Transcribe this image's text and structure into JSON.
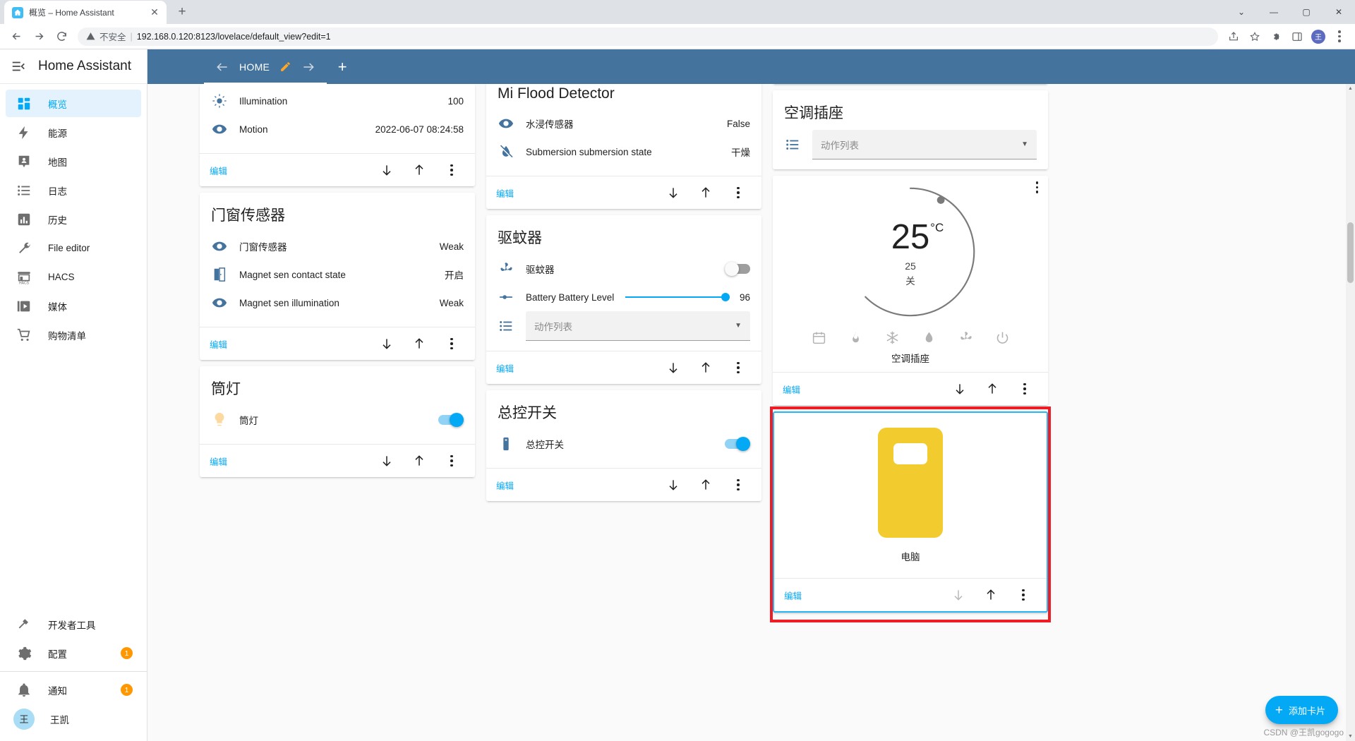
{
  "browser": {
    "tab_title": "概览 – Home Assistant",
    "tab_close": "✕",
    "new_tab": "+",
    "url_warning": "不安全",
    "url_separator": "|",
    "url": "192.168.0.120:8123/lovelace/default_view?edit=1",
    "win_minimize": "—",
    "win_maximize": "▢",
    "win_close": "✕",
    "avatar_initial": "王"
  },
  "sidebar": {
    "title": "Home Assistant",
    "items": [
      {
        "label": "概览",
        "icon": "view-dashboard-icon",
        "active": true
      },
      {
        "label": "能源",
        "icon": "lightning-bolt-icon",
        "active": false
      },
      {
        "label": "地图",
        "icon": "map-marker-account-icon",
        "active": false
      },
      {
        "label": "日志",
        "icon": "format-list-bulleted-icon",
        "active": false
      },
      {
        "label": "历史",
        "icon": "chart-box-icon",
        "active": false
      },
      {
        "label": "File editor",
        "icon": "wrench-icon",
        "active": false
      },
      {
        "label": "HACS",
        "icon": "store-icon",
        "active": false
      },
      {
        "label": "媒体",
        "icon": "play-box-multiple-icon",
        "active": false
      },
      {
        "label": "购物清单",
        "icon": "cart-icon",
        "active": false
      }
    ],
    "bottom_items": [
      {
        "label": "开发者工具",
        "icon": "hammer-wrench-icon",
        "badge": ""
      },
      {
        "label": "配置",
        "icon": "cog-icon",
        "badge": "1"
      }
    ],
    "notifications": {
      "label": "通知",
      "icon": "bell-icon",
      "badge": "1"
    },
    "user": {
      "label": "王凯",
      "initial": "王"
    }
  },
  "ha_toolbar": {
    "view_tab": "HOME",
    "prev_arrow": "arrow-left-icon",
    "next_arrow": "arrow-right-icon",
    "edit_pencil": "pencil-icon",
    "add_view": "+"
  },
  "actions": {
    "edit": "编辑",
    "move_down": "arrow-down-icon",
    "move_up": "arrow-up-icon",
    "more": "dots-vertical-icon"
  },
  "columns": [
    {
      "cards": [
        {
          "type": "entities",
          "title": "",
          "rows": [
            {
              "icon": "brightness-icon",
              "name": "Illumination",
              "value": "100",
              "control": "text"
            },
            {
              "icon": "eye-icon",
              "name": "Motion",
              "value": "2022-06-07 08:24:58",
              "control": "text"
            }
          ]
        },
        {
          "type": "entities",
          "title": "门窗传感器",
          "rows": [
            {
              "icon": "eye-icon",
              "name": "门窗传感器",
              "value": "Weak",
              "control": "text"
            },
            {
              "icon": "door-icon",
              "name": "Magnet sen contact state",
              "value": "开启",
              "control": "text"
            },
            {
              "icon": "eye-icon",
              "name": "Magnet sen illumination",
              "value": "Weak",
              "control": "text"
            }
          ]
        },
        {
          "type": "entities",
          "title": "筒灯",
          "rows": [
            {
              "icon": "lightbulb-icon",
              "name": "筒灯",
              "value": "",
              "control": "toggle-on"
            }
          ]
        }
      ]
    },
    {
      "cards": [
        {
          "type": "entities",
          "title": "Mi Flood Detector",
          "rows": [
            {
              "icon": "eye-icon",
              "name": "水浸传感器",
              "value": "False",
              "control": "text"
            },
            {
              "icon": "water-off-icon",
              "name": "Submersion submersion state",
              "value": "干燥",
              "control": "text"
            }
          ]
        },
        {
          "type": "entities",
          "title": "驱蚊器",
          "rows": [
            {
              "icon": "fan-icon",
              "name": "驱蚊器",
              "value": "",
              "control": "toggle-off"
            },
            {
              "icon": "battery-icon",
              "name": "Battery Battery Level",
              "value": "96",
              "control": "slider"
            },
            {
              "icon": "format-list-bulleted-icon",
              "name": "",
              "value": "",
              "control": "select",
              "placeholder": "动作列表"
            }
          ]
        },
        {
          "type": "entities",
          "title": "总控开关",
          "rows": [
            {
              "icon": "remote-icon",
              "name": "总控开关",
              "value": "",
              "control": "toggle-on"
            }
          ]
        }
      ]
    },
    {
      "cards": [
        {
          "type": "entities",
          "title": "空调插座",
          "rows": [
            {
              "icon": "format-list-bulleted-icon",
              "name": "",
              "value": "",
              "control": "select",
              "placeholder": "动作列表"
            }
          ],
          "no_actions": true
        },
        {
          "type": "thermostat",
          "current_temp": "25",
          "unit": "°C",
          "target_temp": "25",
          "state": "关",
          "name": "空调插座",
          "modes": [
            "calendar-sync-icon",
            "fire-icon",
            "snowflake-icon",
            "water-percent-icon",
            "fan-icon",
            "power-icon"
          ]
        },
        {
          "type": "picture-entity",
          "label": "电脑",
          "selected": true,
          "image": "yellow-computer-tower"
        }
      ]
    }
  ],
  "fab": {
    "plus": "+",
    "label": "添加卡片"
  },
  "watermark": "CSDN @王凯gogogo"
}
